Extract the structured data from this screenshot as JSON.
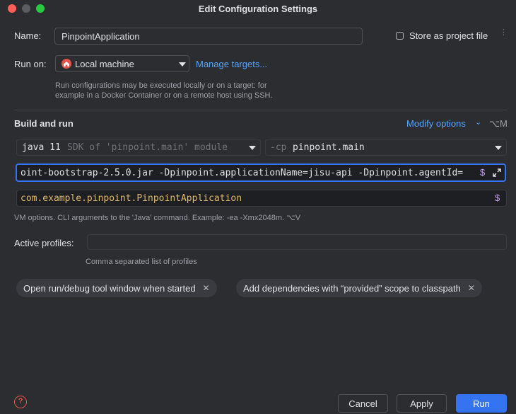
{
  "window": {
    "title": "Edit Configuration Settings",
    "traffic_lights": {
      "close": "#ff5f57",
      "minimize": "#5a5c61",
      "maximize": "#28c840"
    }
  },
  "name": {
    "label": "Name:",
    "value": "PinpointApplication"
  },
  "store_project_file": {
    "label": "Store as project file",
    "checked": false
  },
  "run_on": {
    "label": "Run on:",
    "value": "Local machine",
    "manage_link": "Manage targets...",
    "hint_line1": "Run configurations may be executed locally or on a target: for",
    "hint_line2": "example in a Docker Container or on a remote host using SSH."
  },
  "build_and_run": {
    "heading": "Build and run",
    "modify_options": "Modify options",
    "modify_shortcut": "⌥M",
    "jdk_version": "java 11",
    "jdk_desc": "SDK of 'pinpoint.main' module",
    "cp_prefix": "-cp",
    "cp_value": "pinpoint.main",
    "vm_options": "oint-bootstrap-2.5.0.jar -Dpinpoint.applicationName=jisu-api -Dpinpoint.agentId=",
    "main_class": "com.example.pinpoint.PinpointApplication",
    "vm_hint": "VM options. CLI arguments to the 'Java' command. Example: -ea -Xmx2048m. ⌥V"
  },
  "active_profiles": {
    "label": "Active profiles:",
    "value": "",
    "hint": "Comma separated list of profiles"
  },
  "chips": [
    {
      "label": "Open run/debug tool window when started"
    },
    {
      "label": "Add dependencies with “provided” scope to classpath"
    }
  ],
  "buttons": {
    "cancel": "Cancel",
    "apply": "Apply",
    "run": "Run"
  },
  "icons": {
    "dollar": "$",
    "help": "?"
  }
}
